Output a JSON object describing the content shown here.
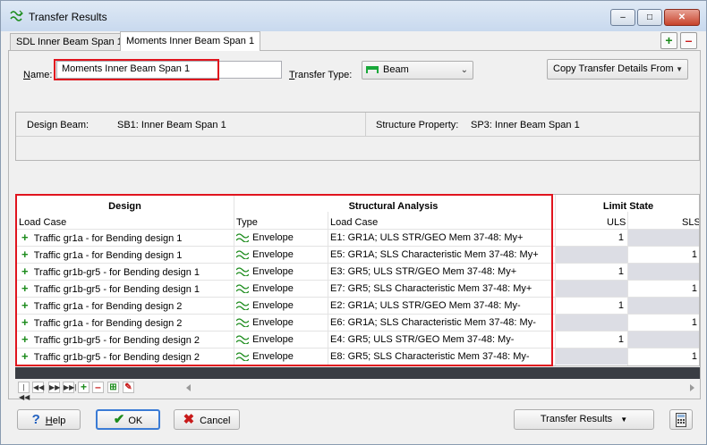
{
  "window": {
    "title": "Transfer Results",
    "minimize": "–",
    "maximize": "□",
    "close": "✕"
  },
  "tabs": [
    {
      "label": "SDL Inner Beam Span 1"
    },
    {
      "label": "Moments Inner Beam Span 1"
    }
  ],
  "tab_buttons": {
    "add": "+",
    "remove": "–"
  },
  "form": {
    "name_label": "Name:",
    "name_value": "Moments Inner Beam Span 1",
    "transfer_type_label": "Transfer Type:",
    "transfer_type_value": "Beam",
    "copy_button": "Copy Transfer Details From"
  },
  "info": {
    "design_beam_label": "Design Beam:",
    "design_beam_value": "SB1: Inner Beam Span 1",
    "structure_property_label": "Structure Property:",
    "structure_property_value": "SP3: Inner Beam Span 1"
  },
  "grid": {
    "groups": {
      "design": "Design",
      "structural_analysis": "Structural Analysis",
      "limit_state": "Limit State"
    },
    "subheaders": {
      "load_case": "Load Case",
      "type": "Type",
      "sa_load_case": "Load Case",
      "uls": "ULS",
      "sls": "SLS"
    },
    "rows": [
      {
        "design": "Traffic gr1a - for Bending design 1",
        "type": "Envelope",
        "load_case": "E1: GR1A; ULS STR/GEO Mem 37-48: My+",
        "uls": "1",
        "sls": ""
      },
      {
        "design": "Traffic gr1a - for Bending design 1",
        "type": "Envelope",
        "load_case": "E5: GR1A; SLS Characteristic Mem 37-48: My+",
        "uls": "",
        "sls": "1"
      },
      {
        "design": "Traffic gr1b-gr5 - for Bending design 1",
        "type": "Envelope",
        "load_case": "E3: GR5; ULS STR/GEO Mem 37-48: My+",
        "uls": "1",
        "sls": ""
      },
      {
        "design": "Traffic gr1b-gr5 - for Bending design 1",
        "type": "Envelope",
        "load_case": "E7: GR5; SLS Characteristic Mem 37-48: My+",
        "uls": "",
        "sls": "1"
      },
      {
        "design": "Traffic gr1a - for Bending design 2",
        "type": "Envelope",
        "load_case": "E2: GR1A; ULS STR/GEO Mem 37-48: My-",
        "uls": "1",
        "sls": ""
      },
      {
        "design": "Traffic gr1a - for Bending design 2",
        "type": "Envelope",
        "load_case": "E6: GR1A; SLS Characteristic Mem 37-48: My-",
        "uls": "",
        "sls": "1"
      },
      {
        "design": "Traffic gr1b-gr5 - for Bending design 2",
        "type": "Envelope",
        "load_case": "E4: GR5; ULS STR/GEO Mem 37-48: My-",
        "uls": "1",
        "sls": ""
      },
      {
        "design": "Traffic gr1b-gr5 - for Bending design 2",
        "type": "Envelope",
        "load_case": "E8: GR5; SLS Characteristic Mem 37-48: My-",
        "uls": "",
        "sls": "1"
      }
    ]
  },
  "navigator": {
    "first": "|◀◀",
    "prev": "◀◀",
    "next": "▶▶",
    "last": "▶▶|",
    "add": "+",
    "remove": "–"
  },
  "footer": {
    "help": "Help",
    "ok": "OK",
    "cancel": "Cancel",
    "transfer_results": "Transfer Results"
  },
  "colors": {
    "highlight": "#e0141e",
    "add": "#1b8b1b",
    "remove": "#c81a1a",
    "cell_gray": "#dcdde4"
  }
}
